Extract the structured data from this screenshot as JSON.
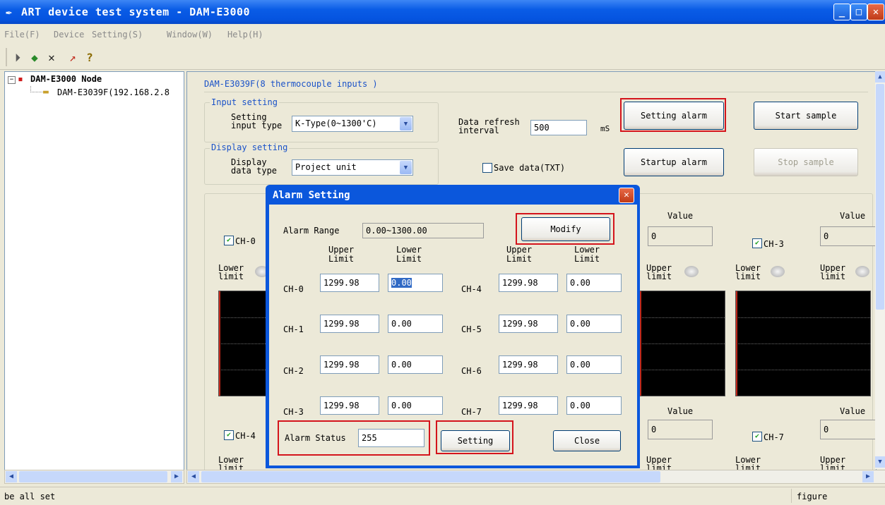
{
  "window": {
    "title": "ART device test system - DAM-E3000",
    "icon": "pen-icon"
  },
  "menu": [
    "File(F)",
    "Device",
    "Setting(S)",
    "Window(W)",
    "Help(H)"
  ],
  "toolbar_icons": [
    "open-icon",
    "connect-icon",
    "delete-icon",
    "draw-icon",
    "help-icon"
  ],
  "tree": {
    "root": "DAM-E3000 Node",
    "child": "DAM-E3039F(192.168.2.8"
  },
  "device": {
    "title": "DAM-E3039F(8 thermocouple inputs )",
    "input_group": "Input setting",
    "input_label": "Setting\ninput type",
    "input_value": "K-Type(0~1300'C)",
    "display_group": "Display setting",
    "display_label": "Display\ndata type",
    "display_value": "Project unit",
    "refresh_label": "Data refresh\ninterval",
    "refresh_value": "500",
    "refresh_unit": "mS",
    "save_label": "Save data(TXT)",
    "setting_alarm": "Setting alarm",
    "start_sample": "Start sample",
    "startup_alarm": "Startup alarm",
    "stop_sample": "Stop sample"
  },
  "channels": {
    "value_label": "Value",
    "value": "0",
    "lower_limit": "Lower\nlimit",
    "upper_limit": "Upper\nlimit",
    "ch0": "CH-0",
    "ch3": "CH-3",
    "ch4": "CH-4",
    "ch7": "CH-7"
  },
  "dialog": {
    "title": "Alarm Setting",
    "alarm_range_label": "Alarm Range",
    "alarm_range_value": "0.00~1300.00",
    "modify": "Modify",
    "upper_header": "Upper\nLimit",
    "lower_header": "Lower\nLimit",
    "rows_left": [
      {
        "ch": "CH-0",
        "upper": "1299.98",
        "lower": "0.00"
      },
      {
        "ch": "CH-1",
        "upper": "1299.98",
        "lower": "0.00"
      },
      {
        "ch": "CH-2",
        "upper": "1299.98",
        "lower": "0.00"
      },
      {
        "ch": "CH-3",
        "upper": "1299.98",
        "lower": "0.00"
      }
    ],
    "rows_right": [
      {
        "ch": "CH-4",
        "upper": "1299.98",
        "lower": "0.00"
      },
      {
        "ch": "CH-5",
        "upper": "1299.98",
        "lower": "0.00"
      },
      {
        "ch": "CH-6",
        "upper": "1299.98",
        "lower": "0.00"
      },
      {
        "ch": "CH-7",
        "upper": "1299.98",
        "lower": "0.00"
      }
    ],
    "alarm_status_label": "Alarm Status",
    "alarm_status_value": "255",
    "setting": "Setting",
    "close": "Close"
  },
  "status": {
    "left": "be all set",
    "right": "figure"
  },
  "colors": {
    "titlebar": "#0554e0",
    "highlight": "#d4141c",
    "group_label": "#1a52c8",
    "scope_bg": "#000000"
  }
}
